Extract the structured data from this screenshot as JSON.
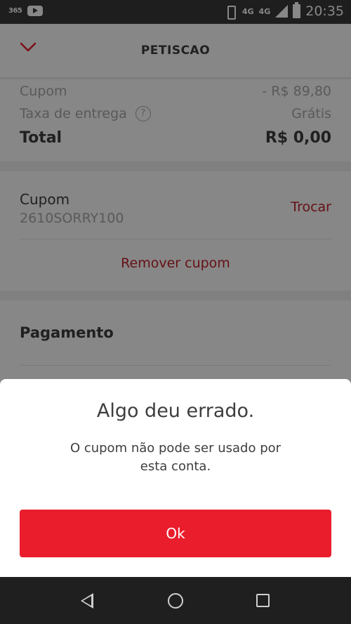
{
  "status_bar": {
    "badge": "365",
    "network": "4G",
    "network_small": "4G",
    "time": "20:35"
  },
  "appbar": {
    "title": "PETISCAO",
    "back_icon": "chevron-down-icon"
  },
  "summary": {
    "coupon_label": "Cupom",
    "coupon_value": "- R$ 89,80",
    "delivery_label": "Taxa de entrega",
    "delivery_help": "?",
    "delivery_value": "Grátis",
    "total_label": "Total",
    "total_value": "R$ 0,00"
  },
  "coupon": {
    "title": "Cupom",
    "code": "2610SORRY100",
    "change_label": "Trocar",
    "remove_label": "Remover cupom"
  },
  "payment": {
    "title": "Pagamento"
  },
  "dialog": {
    "title": "Algo deu errado.",
    "message": "O cupom não pode ser usado por esta conta.",
    "ok_label": "Ok"
  },
  "colors": {
    "accent": "#ea1d2c",
    "link": "#c0202a",
    "text": "#3e3e3e",
    "muted": "#a9a9a9"
  }
}
